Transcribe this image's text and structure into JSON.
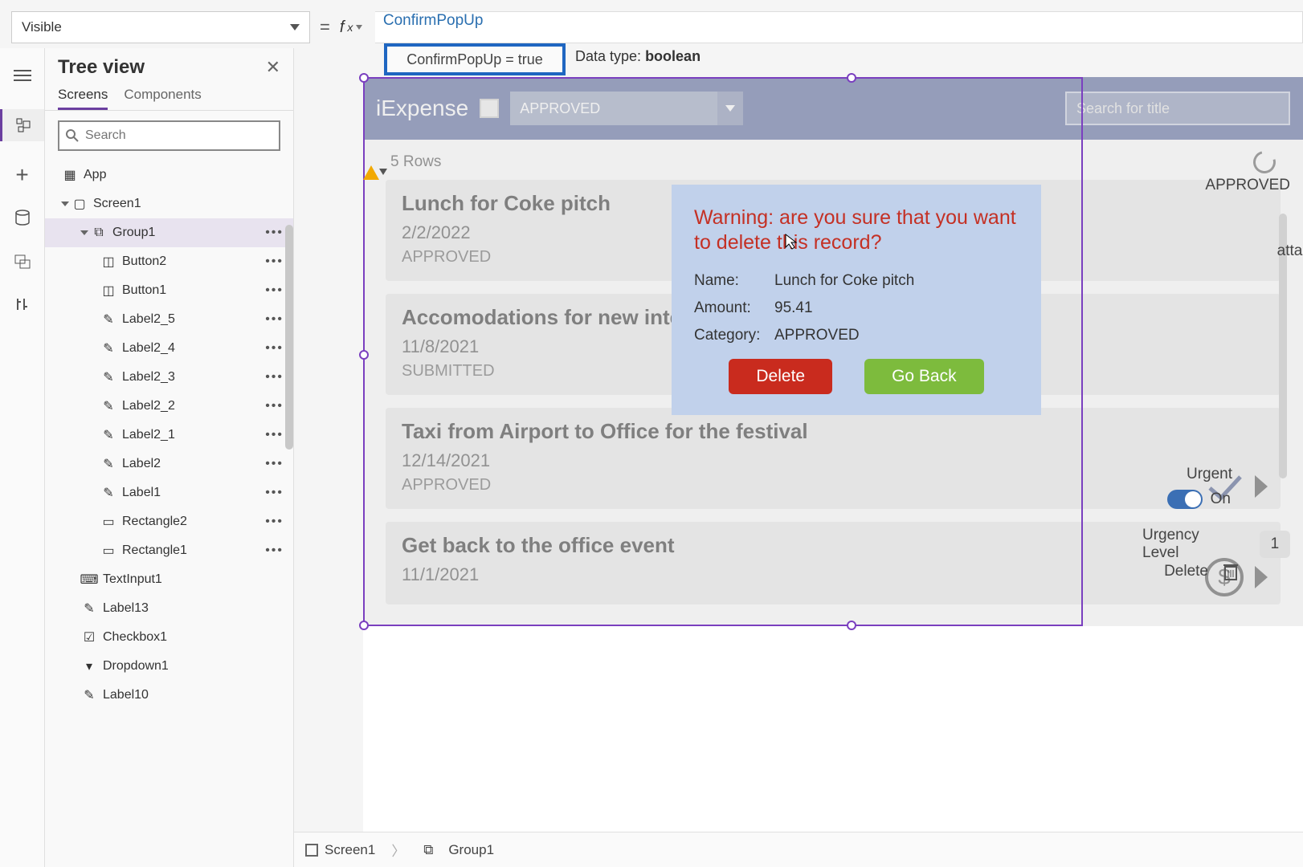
{
  "property_bar": {
    "selected_property": "Visible",
    "formula_text": "ConfirmPopUp",
    "formula_result": "ConfirmPopUp  =  true",
    "data_type_label": "Data type:",
    "data_type_value": "boolean"
  },
  "tree": {
    "title": "Tree view",
    "tabs": {
      "screens": "Screens",
      "components": "Components"
    },
    "search_placeholder": "Search",
    "items": [
      {
        "label": "App",
        "kind": "app"
      },
      {
        "label": "Screen1",
        "kind": "screen"
      },
      {
        "label": "Group1",
        "kind": "group",
        "selected": true
      },
      {
        "label": "Button2",
        "kind": "button"
      },
      {
        "label": "Button1",
        "kind": "button"
      },
      {
        "label": "Label2_5",
        "kind": "label"
      },
      {
        "label": "Label2_4",
        "kind": "label"
      },
      {
        "label": "Label2_3",
        "kind": "label"
      },
      {
        "label": "Label2_2",
        "kind": "label"
      },
      {
        "label": "Label2_1",
        "kind": "label"
      },
      {
        "label": "Label2",
        "kind": "label"
      },
      {
        "label": "Label1",
        "kind": "label"
      },
      {
        "label": "Rectangle2",
        "kind": "rect"
      },
      {
        "label": "Rectangle1",
        "kind": "rect"
      },
      {
        "label": "TextInput1",
        "kind": "textinput"
      },
      {
        "label": "Label13",
        "kind": "label"
      },
      {
        "label": "Checkbox1",
        "kind": "checkbox"
      },
      {
        "label": "Dropdown1",
        "kind": "dropdown"
      },
      {
        "label": "Label10",
        "kind": "label"
      }
    ]
  },
  "app_preview": {
    "title": "iExpense",
    "dropdown_value": "APPROVED",
    "search_placeholder": "Search for title",
    "rows_label": "5 Rows",
    "badge_text": "APPROVED",
    "attach_label": "attache",
    "urgent_label": "Urgent",
    "toggle_label": "On",
    "urgency_label": "Urgency Level",
    "urgency_value": "1",
    "delete_label": "Delete",
    "records": [
      {
        "title": "Lunch for Coke pitch",
        "date": "2/2/2022",
        "status": "APPROVED"
      },
      {
        "title": "Accomodations for new interv",
        "date": "11/8/2021",
        "status": "SUBMITTED"
      },
      {
        "title": "Taxi from Airport to Office for the festival",
        "date": "12/14/2021",
        "status": "APPROVED"
      },
      {
        "title": "Get back to the office event",
        "date": "11/1/2021",
        "status": ""
      }
    ]
  },
  "popup": {
    "warning": "Warning: are you sure that you want to delete this record?",
    "name_label": "Name:",
    "name_value": "Lunch for Coke pitch",
    "amount_label": "Amount:",
    "amount_value": "95.41",
    "category_label": "Category:",
    "category_value": "APPROVED",
    "delete_btn": "Delete",
    "back_btn": "Go Back"
  },
  "breadcrumb": {
    "screen": "Screen1",
    "group": "Group1"
  }
}
